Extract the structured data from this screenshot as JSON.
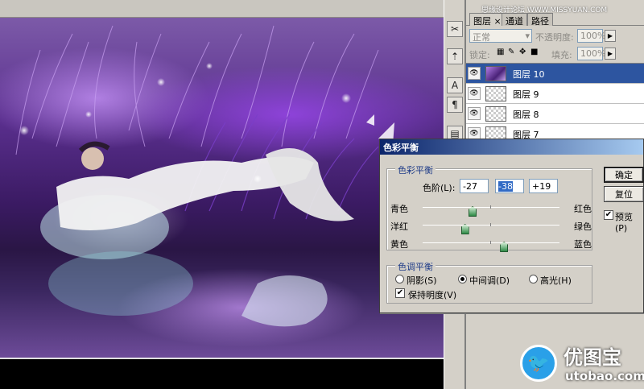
{
  "watermark": {
    "top_text": "思缘设计论坛 WWW.MISSYUAN.COM",
    "logo_cn": "优图宝",
    "logo_url": "utobao.com",
    "bird_icon": "twitter-bird-icon"
  },
  "layers_panel": {
    "tabs": [
      {
        "label": "图层",
        "close": "×"
      },
      {
        "label": "通道"
      },
      {
        "label": "路径"
      }
    ],
    "blend_mode": "正常",
    "opacity_label": "不透明度:",
    "opacity_value": "100%",
    "lock_label": "锁定:",
    "fill_label": "填充:",
    "fill_value": "100%",
    "layers": [
      {
        "name": "图层 10",
        "selected": true
      },
      {
        "name": "图层 9",
        "selected": false
      },
      {
        "name": "图层 8",
        "selected": false
      },
      {
        "name": "图层 7",
        "selected": false
      }
    ]
  },
  "dialog": {
    "title": "色彩平衡",
    "color_balance_group": "色彩平衡",
    "levels_label": "色阶(L):",
    "levels_underline": "L",
    "level_values": [
      "-27",
      "-38",
      "+19"
    ],
    "sliders": [
      {
        "left": "青色",
        "right": "红色",
        "value": -27
      },
      {
        "left": "洋红",
        "right": "绿色",
        "value": -38
      },
      {
        "left": "黄色",
        "right": "蓝色",
        "value": 19
      }
    ],
    "tone_group": "色调平衡",
    "tone_options": [
      {
        "label": "阴影(S)",
        "checked": false
      },
      {
        "label": "中间调(D)",
        "checked": true
      },
      {
        "label": "高光(H)",
        "checked": false
      }
    ],
    "preserve_label": "保持明度(V)",
    "preserve_checked": true,
    "ok_label": "确定",
    "reset_label": "复位",
    "preview_label": "预览(P)",
    "preview_checked": true
  },
  "tools": [
    "scissors-icon",
    "usb-icon",
    "text-tool-icon",
    "paragraph-icon"
  ]
}
